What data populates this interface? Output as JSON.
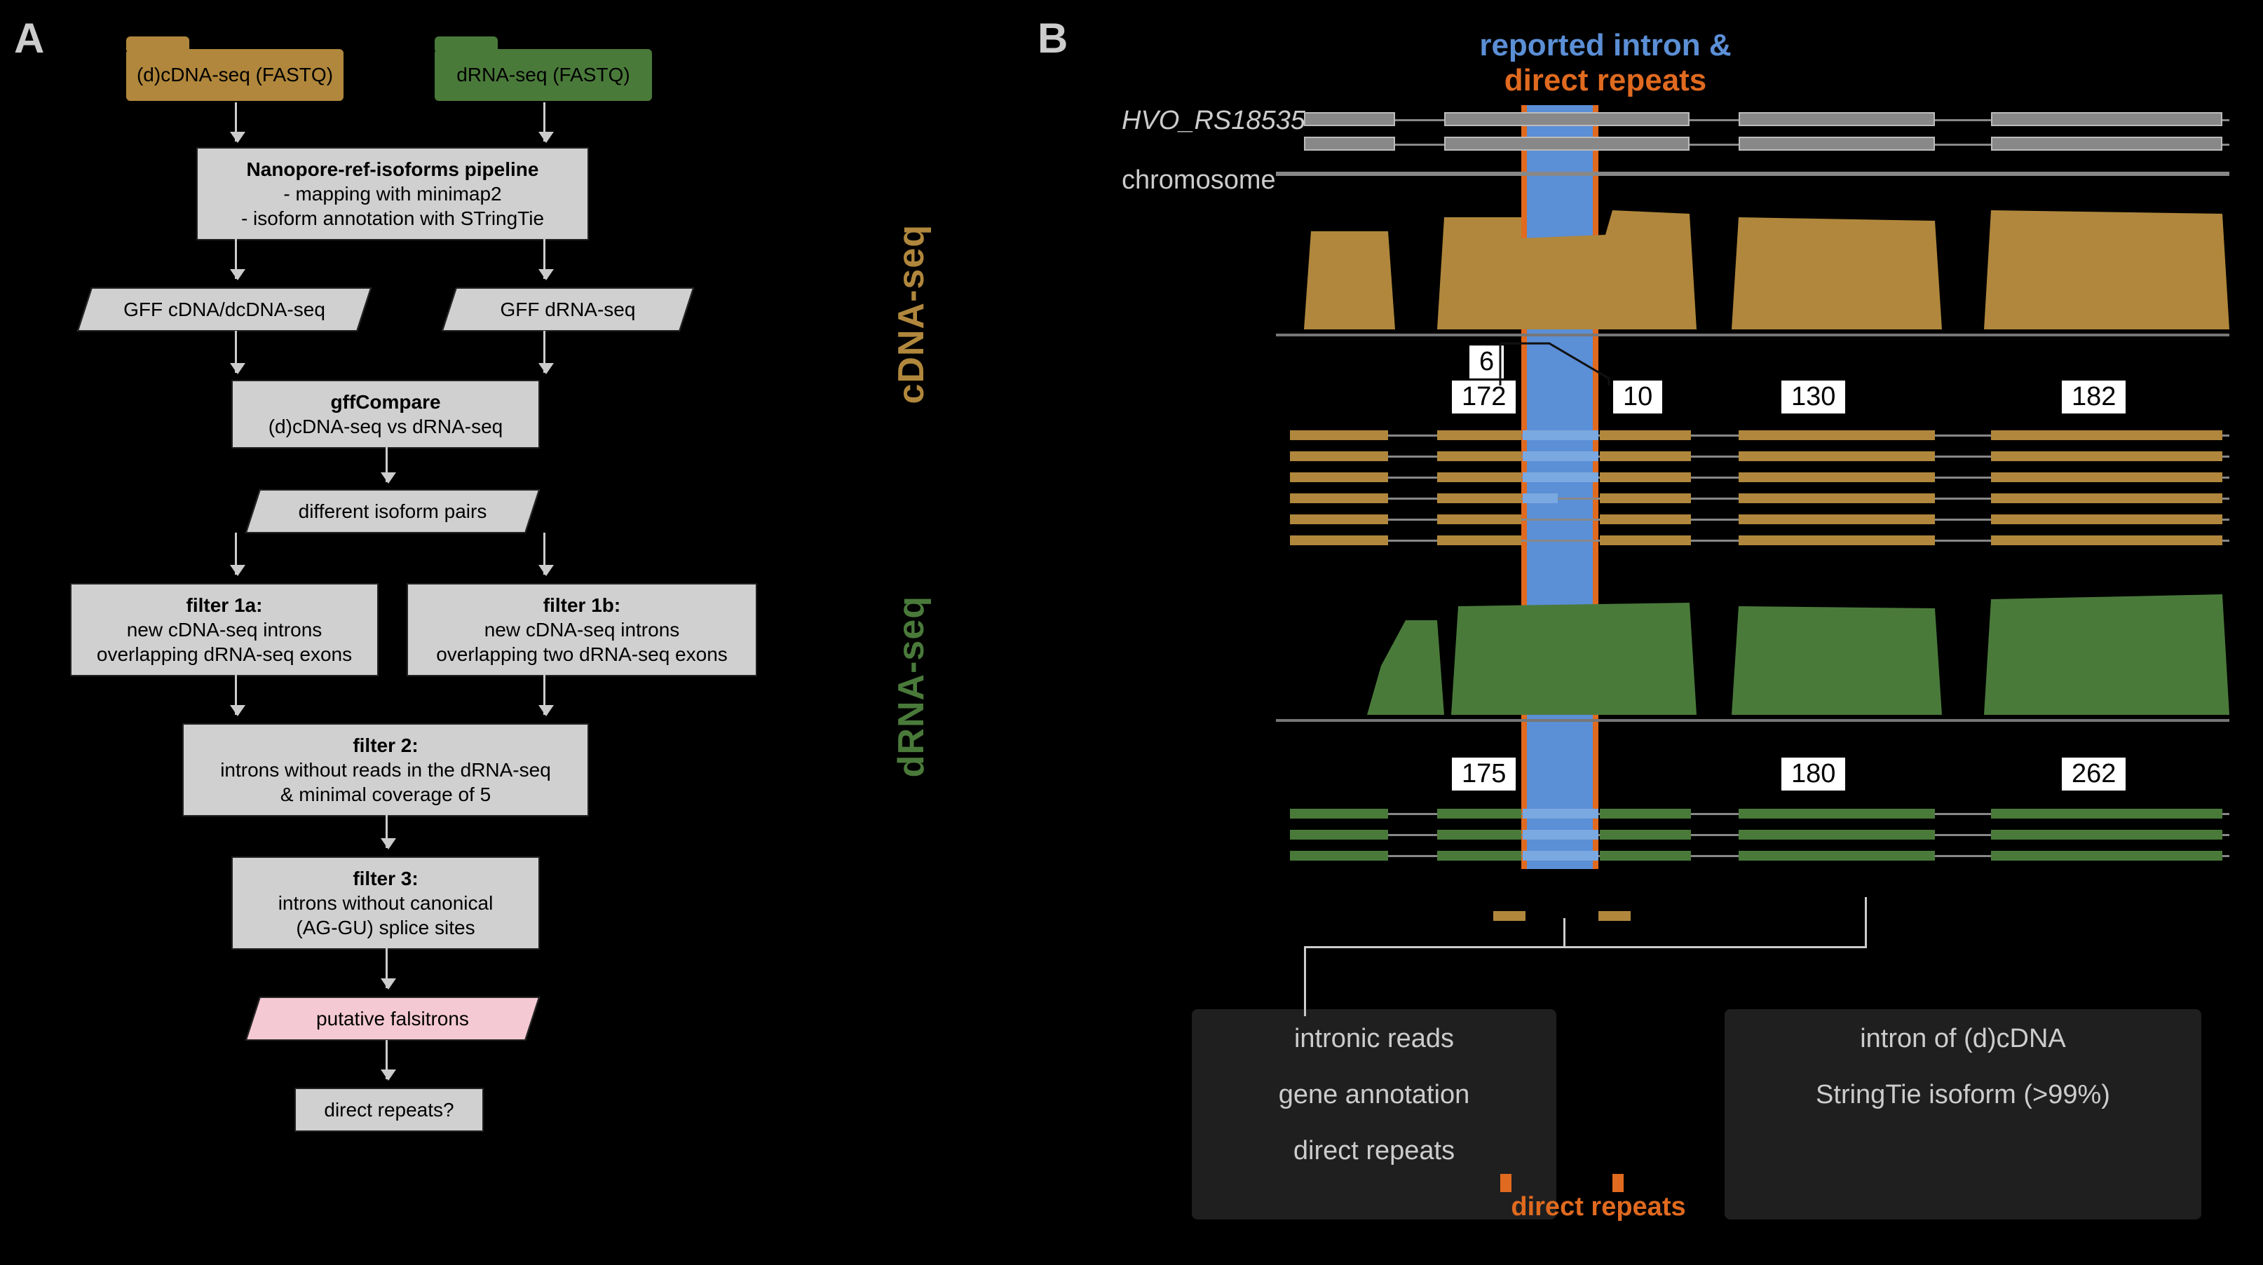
{
  "panels": {
    "a": "A",
    "b": "B"
  },
  "input_tabs": {
    "cdna": "(d)cDNA-seq (FASTQ)",
    "drna": "dRNA-seq (FASTQ)"
  },
  "flow": {
    "nanopore_title": "Nanopore-ref-isoforms pipeline",
    "nanopore_l1": "- mapping with minimap2",
    "nanopore_l2": "- isoform annotation with STringTie",
    "gff_cdna": "GFF cDNA/dcDNA-seq",
    "gff_drna": "GFF dRNA-seq",
    "gffcompare_title": "gffCompare",
    "gffcompare_sub": "(d)cDNA-seq vs dRNA-seq",
    "diff_pairs": "different isoform pairs",
    "f1a_title": "filter 1a:",
    "f1a_l1": "new cDNA-seq introns",
    "f1a_l2": "overlapping dRNA-seq exons",
    "f1b_title": "filter 1b:",
    "f1b_l1": "new cDNA-seq introns",
    "f1b_l2": "overlapping two dRNA-seq exons",
    "f2_title": "filter 2:",
    "f2_l1": "introns without reads in the dRNA-seq",
    "f2_l2": "& minimal coverage of 5",
    "f3_title": "filter 3:",
    "f3_l1": "introns without canonical",
    "f3_l2": "(AG-GU) splice sites",
    "putative": "putative falsitrons",
    "direct_repeats": "direct repeats?"
  },
  "right": {
    "title_line1": "reported intron &",
    "title_line2": "direct repeats",
    "track_cdna": "cDNA-seq",
    "track_drna": "dRNA-seq",
    "gene": "HVO_RS18535",
    "chrom": "chromosome",
    "cdna_counts": {
      "gap": "6",
      "left": "172",
      "mid": "10",
      "right1": "130",
      "right2": "182"
    },
    "drna_counts": {
      "left": "175",
      "right1": "180",
      "right2": "262"
    },
    "bottom": {
      "intronic_reads": "intronic reads",
      "gene_annotation": "gene annotation",
      "direct_repeats": "direct repeats",
      "intron_a": "intron of (d)cDNA",
      "intron_b": "StringTie isoform (>99%)"
    },
    "direct_repeat_detail": "direct repeats",
    "colors": {
      "brown": "#b0873c",
      "green": "#4a7a3a",
      "blue": "#5b8fd6",
      "orange": "#e06a1f"
    }
  }
}
